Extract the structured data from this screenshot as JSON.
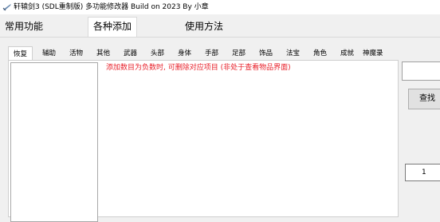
{
  "window": {
    "title": "轩辕剑3 (SDL重制版) 多功能修改器 Build on 2023 By 小章"
  },
  "main_tabs": [
    {
      "label": "常用功能"
    },
    {
      "label": "各种添加"
    },
    {
      "label": "使用方法"
    }
  ],
  "active_main_tab": "各种添加",
  "sub_tabs": [
    {
      "label": "恢复"
    },
    {
      "label": "辅助"
    },
    {
      "label": "活物"
    },
    {
      "label": "其他"
    },
    {
      "label": "武器"
    },
    {
      "label": "头部"
    },
    {
      "label": "身体"
    },
    {
      "label": "手部"
    },
    {
      "label": "足部"
    },
    {
      "label": "饰品"
    },
    {
      "label": "法宝"
    },
    {
      "label": "角色"
    },
    {
      "label": "成就"
    },
    {
      "label": "神魔录"
    }
  ],
  "active_sub_tab": "恢复",
  "hint": {
    "text": "添加数目为负数时, 可删除对应项目 (非处于查看物品界面)",
    "color": "#e8202a"
  },
  "search": {
    "button_label": "查找",
    "input_value": ""
  },
  "quantity": {
    "value": "1"
  }
}
